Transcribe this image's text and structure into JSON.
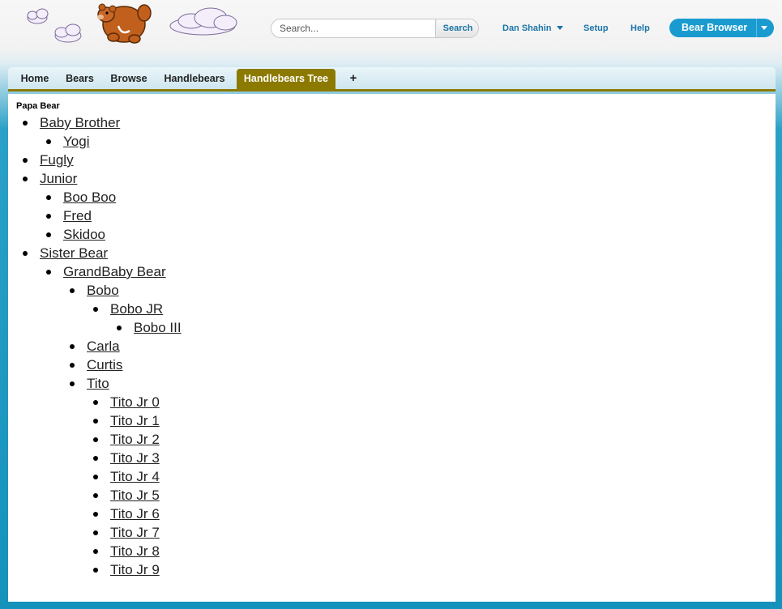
{
  "search": {
    "placeholder": "Search...",
    "button_label": "Search"
  },
  "header": {
    "user_name": "Dan Shahin",
    "setup_label": "Setup",
    "help_label": "Help",
    "app_name": "Bear Browser"
  },
  "tabs": [
    {
      "label": "Home"
    },
    {
      "label": "Bears"
    },
    {
      "label": "Browse"
    },
    {
      "label": "Handlebears"
    },
    {
      "label": "Handlebears Tree",
      "active": true
    },
    {
      "label": "+"
    }
  ],
  "tree": {
    "root_label": "Papa Bear",
    "nodes": [
      {
        "label": "Baby Brother",
        "children": [
          {
            "label": "Yogi",
            "children": []
          }
        ]
      },
      {
        "label": "Fugly",
        "children": []
      },
      {
        "label": "Junior",
        "children": [
          {
            "label": "Boo Boo",
            "children": []
          },
          {
            "label": "Fred",
            "children": []
          },
          {
            "label": "Skidoo",
            "children": []
          }
        ]
      },
      {
        "label": "Sister Bear",
        "children": [
          {
            "label": "GrandBaby Bear",
            "children": [
              {
                "label": "Bobo",
                "children": [
                  {
                    "label": "Bobo JR",
                    "children": [
                      {
                        "label": "Bobo III",
                        "children": []
                      }
                    ]
                  }
                ]
              },
              {
                "label": "Carla",
                "children": []
              },
              {
                "label": "Curtis",
                "children": []
              },
              {
                "label": "Tito",
                "children": [
                  {
                    "label": "Tito Jr 0",
                    "children": []
                  },
                  {
                    "label": "Tito Jr 1",
                    "children": []
                  },
                  {
                    "label": "Tito Jr 2",
                    "children": []
                  },
                  {
                    "label": "Tito Jr 3",
                    "children": []
                  },
                  {
                    "label": "Tito Jr 4",
                    "children": []
                  },
                  {
                    "label": "Tito Jr 5",
                    "children": []
                  },
                  {
                    "label": "Tito Jr 6",
                    "children": []
                  },
                  {
                    "label": "Tito Jr 7",
                    "children": []
                  },
                  {
                    "label": "Tito Jr 8",
                    "children": []
                  },
                  {
                    "label": "Tito Jr 9",
                    "children": []
                  }
                ]
              }
            ]
          }
        ]
      }
    ]
  },
  "colors": {
    "accent": "#1a74a8",
    "active_tab": "#8c7a00",
    "app_switcher": "#1a9bd0"
  }
}
